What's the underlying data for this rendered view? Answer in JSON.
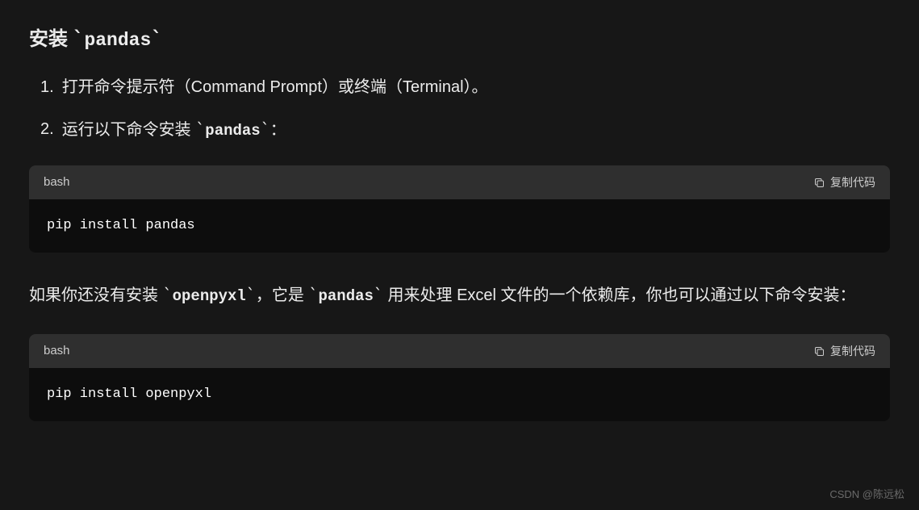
{
  "heading": {
    "prefix": "安装",
    "code": "pandas"
  },
  "steps": [
    {
      "num": "1.",
      "text": "打开命令提示符（Command Prompt）或终端（Terminal）。"
    },
    {
      "num": "2.",
      "text_before": "运行以下命令安装",
      "code": "pandas",
      "text_after": "："
    }
  ],
  "code_block_1": {
    "lang": "bash",
    "copy_label": "复制代码",
    "code": "pip install pandas"
  },
  "paragraph": {
    "t1": "如果你还没有安装",
    "c1": "openpyxl",
    "t2": "，它是",
    "c2": "pandas",
    "t3": "用来处理 Excel 文件的一个依赖库，你也可以通过以下命令安装：",
    "wrap_hint": "如果你还没有安装 `openpyxl`，它是 `pandas` 用来处理 Excel 文件的一个依赖库，你也可以通过以下命令安装："
  },
  "code_block_2": {
    "lang": "bash",
    "copy_label": "复制代码",
    "code": "pip install openpyxl"
  },
  "watermark": "CSDN @陈远松"
}
